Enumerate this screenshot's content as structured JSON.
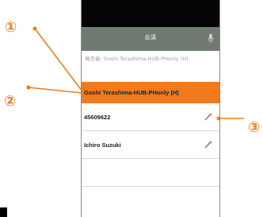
{
  "callouts": {
    "one": "①",
    "two": "②",
    "three": "③"
  },
  "header": {
    "title": "会議",
    "mic_icon": "microphone-icon"
  },
  "speaker_info": {
    "text": "発言者: Goshi Terashima-HUB-PHonly (H)"
  },
  "participants": [
    {
      "name": "Goshi Terashima-HUB-PHonly (H)",
      "highlighted": true
    },
    {
      "name": "45609622",
      "icon": "mute-icon"
    },
    {
      "name": "Ichiro Suzuki",
      "icon": "mute-icon"
    }
  ],
  "colors": {
    "accent": "#f07a1c",
    "header_bg": "#6f7a70",
    "status_bar": "#050505"
  }
}
